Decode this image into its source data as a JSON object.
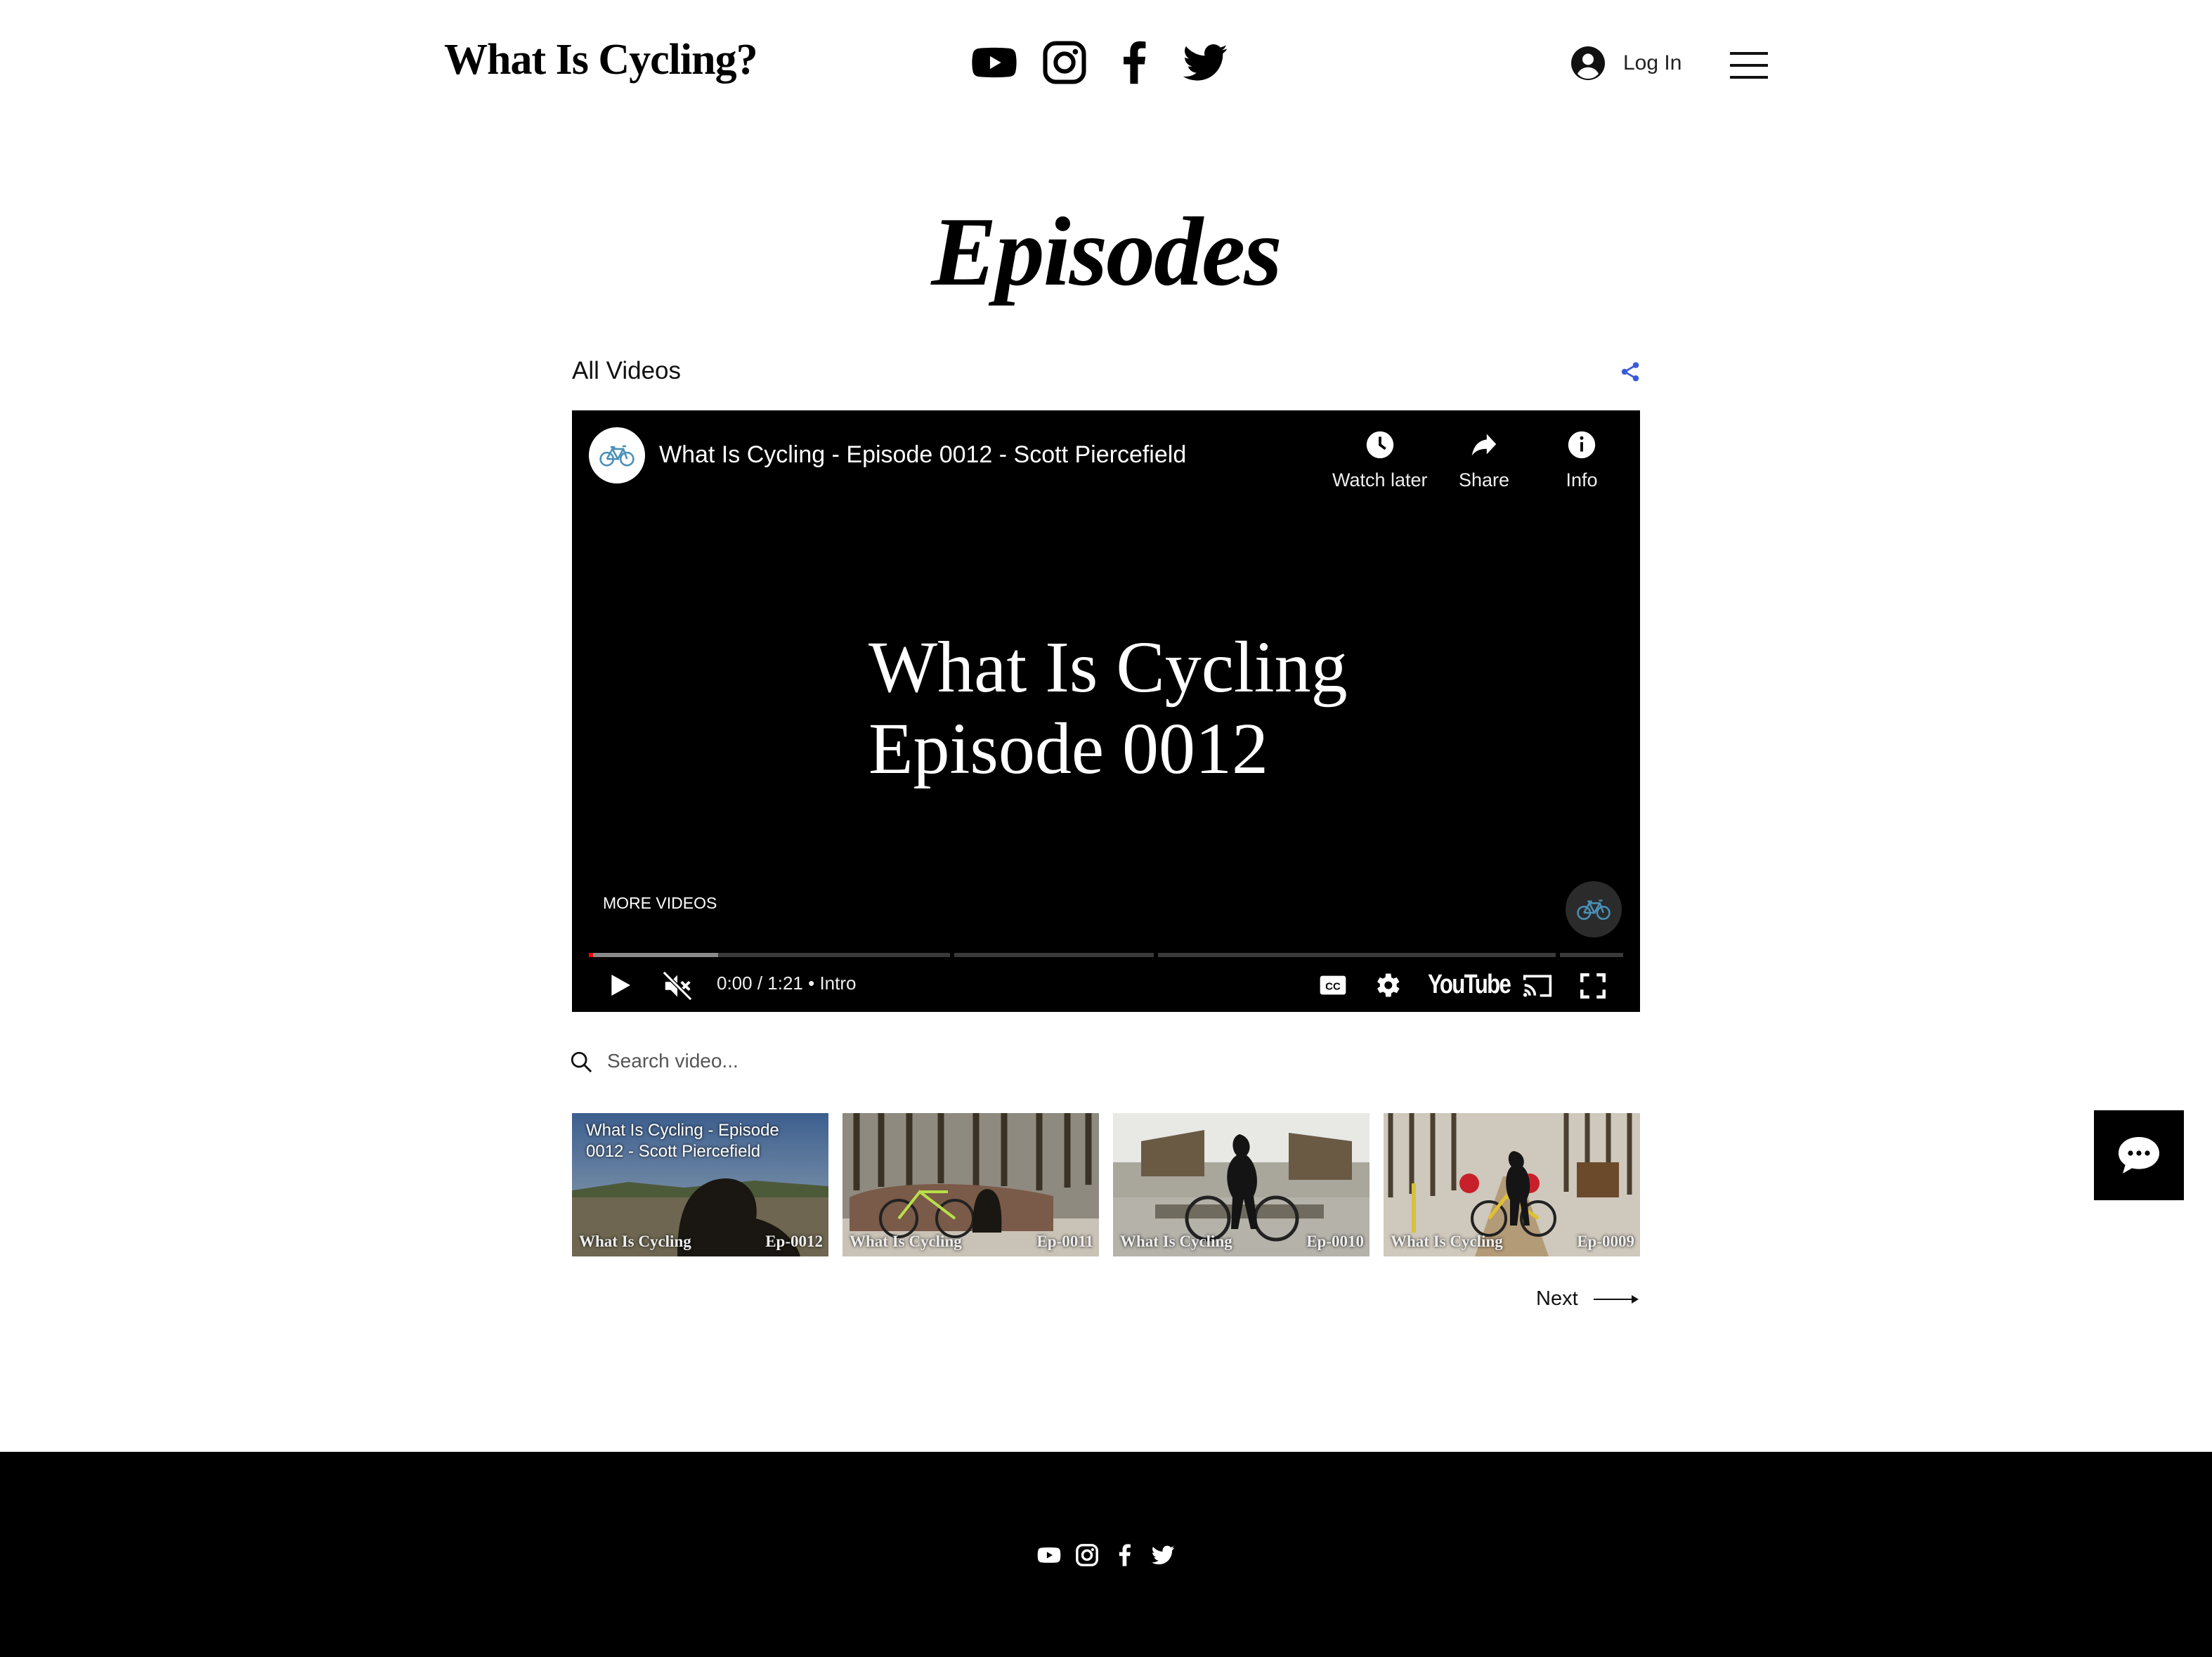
{
  "header": {
    "site_title": "What Is Cycling?",
    "social_icons": [
      "youtube-icon",
      "instagram-icon",
      "facebook-icon",
      "twitter-icon"
    ],
    "login_label": "Log In"
  },
  "page": {
    "title": "Episodes",
    "collection_label": "All Videos"
  },
  "player": {
    "video_title": "What Is Cycling - Episode 0012 - Scott Piercefield",
    "actions": {
      "watch_later": "Watch later",
      "share": "Share",
      "info": "Info"
    },
    "slate_line1": "What Is Cycling",
    "slate_line2": "Episode 0012",
    "more_videos": "MORE VIDEOS",
    "time_display": "0:00 / 1:21",
    "chapter": "Intro",
    "youtube_logo": "YouTube",
    "progress_played_fraction": 0.0,
    "buffered_fraction": 0.125
  },
  "search": {
    "placeholder": "Search video..."
  },
  "thumbnails": [
    {
      "overlay_title": "What Is Cycling - Episode 0012 - Scott Piercefield",
      "caption": "What Is Cycling",
      "episode": "Ep-0012"
    },
    {
      "overlay_title": "",
      "caption": "What Is Cycling",
      "episode": "Ep-0011"
    },
    {
      "overlay_title": "",
      "caption": "What Is Cycling",
      "episode": "Ep-0010"
    },
    {
      "overlay_title": "",
      "caption": "What Is Cycling",
      "episode": "Ep-0009"
    }
  ],
  "pagination": {
    "next_label": "Next"
  },
  "colors": {
    "accent_share": "#3b5bdb",
    "progress_red": "#ff0000",
    "footer_bg": "#000000"
  }
}
